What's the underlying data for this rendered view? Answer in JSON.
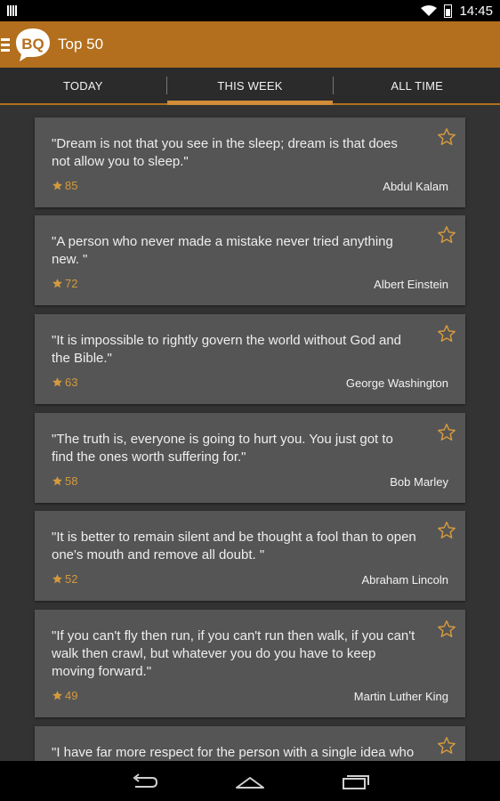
{
  "status_bar": {
    "time": "14:45"
  },
  "app_bar": {
    "title": "Top 50",
    "logo_text": "BQ"
  },
  "tabs": [
    {
      "label": "TODAY",
      "active": false
    },
    {
      "label": "THIS WEEK",
      "active": true
    },
    {
      "label": "ALL TIME",
      "active": false
    }
  ],
  "quotes": [
    {
      "text": "\"Dream is not that you see in the sleep; dream is that does not allow you to sleep.\"",
      "score": "85",
      "author": "Abdul Kalam"
    },
    {
      "text": "\"A person who never made a mistake never tried anything new. \"",
      "score": "72",
      "author": "Albert Einstein"
    },
    {
      "text": "\"It is impossible to rightly govern the world without God and the Bible.\"",
      "score": "63",
      "author": "George Washington"
    },
    {
      "text": "\"The truth is, everyone is going to hurt you. You just got to find the ones worth suffering for.\"",
      "score": "58",
      "author": "Bob Marley"
    },
    {
      "text": "\"It is better to remain silent and be thought a fool than to open one's mouth and remove all doubt. \"",
      "score": "52",
      "author": "Abraham Lincoln"
    },
    {
      "text": "\"If you can't fly then run, if you can't run then walk, if you can't walk then crawl, but whatever you do you have to keep moving forward.\"",
      "score": "49",
      "author": "Martin Luther King"
    },
    {
      "text": "\"I have far more respect for the person with a single idea who",
      "score": "",
      "author": ""
    }
  ],
  "colors": {
    "accent": "#b36f1d",
    "star": "#d49a3e",
    "card": "#555555",
    "background": "#333333"
  }
}
